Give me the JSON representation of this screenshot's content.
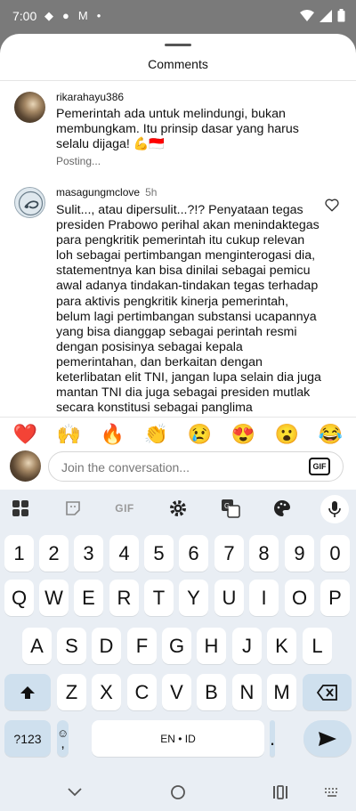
{
  "status_bar": {
    "time": "7:00"
  },
  "sheet": {
    "title": "Comments"
  },
  "comments": [
    {
      "username": "rikarahayu386",
      "time": "",
      "text": "Pemerintah ada untuk melindungi, bukan membungkam. Itu prinsip dasar yang harus selalu dijaga! 💪🇮🇩",
      "status": "Posting..."
    },
    {
      "username": "masagungmclove",
      "time": "5h",
      "text": "Sulit..., atau dipersulit...?!? Penyataan tegas presiden Prabowo perihal akan menindaktegas para pengkritik pemerintah itu cukup relevan loh sebagai pertimbangan menginterogasi dia, statementnya kan bisa dinilai sebagai pemicu awal adanya tindakan-tindakan tegas terhadap para aktivis pengkritik kinerja pemerintah, belum lagi pertimbangan substansi ucapannya yang bisa dianggap sebagai perintah resmi dengan posisinya sebagai kepala pemerintahan, dan berkaitan dengan keterlibatan elit TNI, jangan lupa selain dia juga mantan TNI dia juga sebagai presiden mutlak secara konstitusi sebagai panglima"
    }
  ],
  "reactions": [
    "❤️",
    "🙌",
    "🔥",
    "👏",
    "😢",
    "😍",
    "😮",
    "😂"
  ],
  "composer": {
    "placeholder": "Join the conversation...",
    "gif_label": "GIF"
  },
  "keyboard": {
    "toolbar_gif": "GIF",
    "number_row": [
      "1",
      "2",
      "3",
      "4",
      "5",
      "6",
      "7",
      "8",
      "9",
      "0"
    ],
    "row1": [
      "Q",
      "W",
      "E",
      "R",
      "T",
      "Y",
      "U",
      "I",
      "O",
      "P"
    ],
    "row2": [
      "A",
      "S",
      "D",
      "F",
      "G",
      "H",
      "J",
      "K",
      "L"
    ],
    "row3": [
      "Z",
      "X",
      "C",
      "V",
      "B",
      "N",
      "M"
    ],
    "symbols_label": "?123",
    "emoji_key": "☺",
    "comma_key": ",",
    "space_label": "EN • ID",
    "period_key": "."
  },
  "colors": {
    "special_key": "#cfe0ee",
    "keyboard_bg": "#e9eef4",
    "scrim": "#7a7a7a"
  }
}
